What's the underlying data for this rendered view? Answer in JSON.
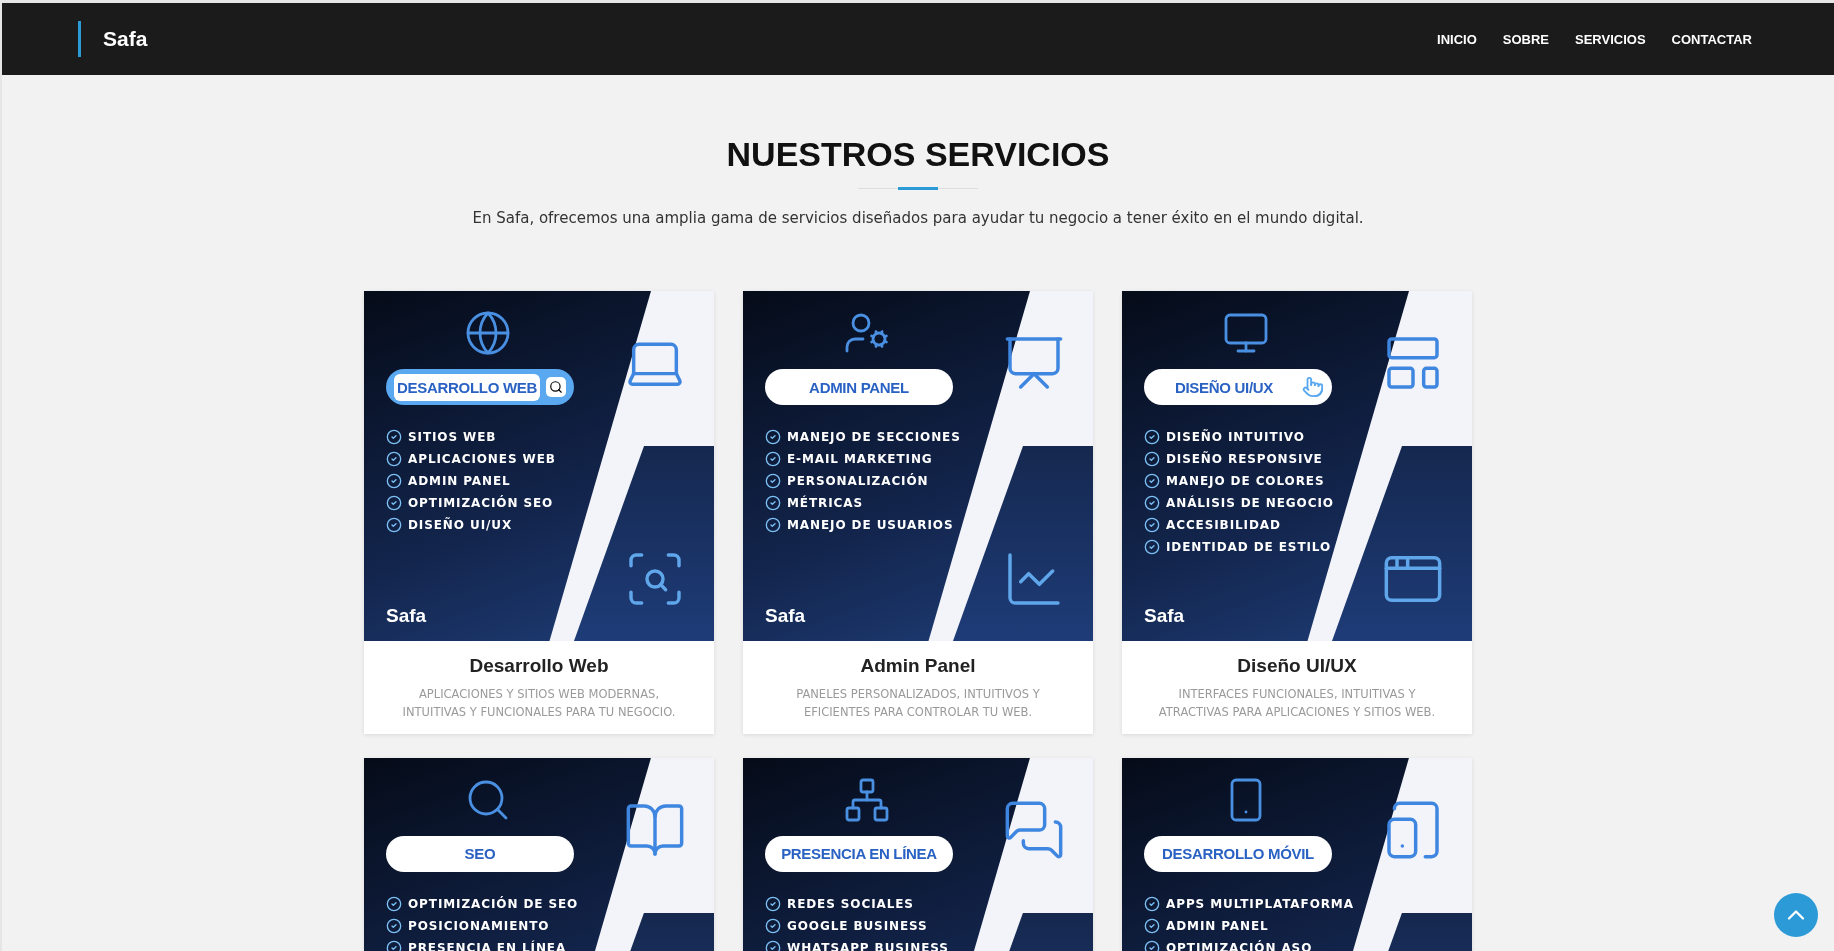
{
  "header": {
    "logo": "Safa",
    "nav": [
      {
        "label": "INICIO"
      },
      {
        "label": "SOBRE"
      },
      {
        "label": "SERVICIOS"
      },
      {
        "label": "CONTACTAR"
      }
    ]
  },
  "section": {
    "title": "NUESTROS SERVICIOS",
    "subtitle": "En Safa, ofrecemos una amplia gama de servicios diseñados para ayudar tu negocio a tener éxito en el mundo digital."
  },
  "cards": [
    {
      "banner": {
        "label": "DESARROLLO WEB",
        "kind": "search",
        "features": [
          "SITIOS WEB",
          "APLICACIONES WEB",
          "ADMIN PANEL",
          "OPTIMIZACIÓN SEO",
          "DISEÑO UI/UX"
        ],
        "brand": "Safa"
      },
      "title": "Desarrollo Web",
      "description": "APLICACIONES Y SITIOS WEB MODERNAS, INTUITIVAS Y FUNCIONALES PARA TU NEGOCIO."
    },
    {
      "banner": {
        "label": "ADMIN PANEL",
        "kind": "plain",
        "features": [
          "MANEJO DE SECCIONES",
          "E-MAIL MARKETING",
          "PERSONALIZACIÓN",
          "MÉTRICAS",
          "MANEJO DE USUARIOS"
        ],
        "brand": "Safa"
      },
      "title": "Admin Panel",
      "description": "PANELES PERSONALIZADOS, INTUITIVOS Y EFICIENTES PARA CONTROLAR TU WEB."
    },
    {
      "banner": {
        "label": "DISEÑO UI/UX",
        "kind": "pointer",
        "features": [
          "DISEÑO INTUITIVO",
          "DISEÑO RESPONSIVE",
          "MANEJO DE COLORES",
          "ANÁLISIS DE NEGOCIO",
          "ACCESIBILIDAD",
          "IDENTIDAD DE ESTILO"
        ],
        "brand": "Safa"
      },
      "title": "Diseño UI/UX",
      "description": "INTERFACES FUNCIONALES, INTUITIVAS Y ATRACTIVAS PARA APLICACIONES Y SITIOS WEB."
    },
    {
      "banner": {
        "label": "SEO",
        "kind": "plain",
        "features": [
          "OPTIMIZACIÓN DE SEO",
          "POSICIONAMIENTO",
          "PRESENCIA EN LÍNEA"
        ]
      }
    },
    {
      "banner": {
        "label": "PRESENCIA EN LÍNEA",
        "kind": "plain",
        "features": [
          "REDES SOCIALES",
          "GOOGLE BUSINESS",
          "WHATSAPP BUSINESS"
        ]
      }
    },
    {
      "banner": {
        "label": "DESARROLLO MÓVIL",
        "kind": "plain",
        "features": [
          "APPS MULTIPLATAFORMA",
          "ADMIN PANEL",
          "OPTIMIZACIÓN ASO"
        ]
      }
    }
  ]
}
